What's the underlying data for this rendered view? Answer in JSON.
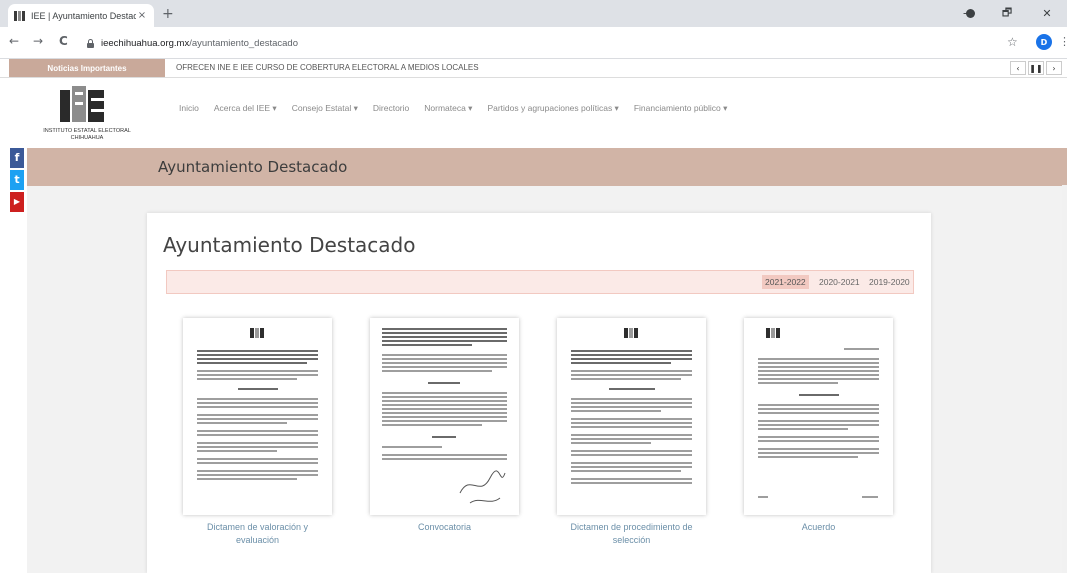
{
  "browser": {
    "tab_title": "IEE | Ayuntamiento Destacado",
    "tab_close": "×",
    "new_tab": "+",
    "url_domain": "ieechihuahua.org.mx",
    "url_path": "/ayuntamiento_destacado",
    "profile_initial": "D",
    "back": "←",
    "forward": "→",
    "reload": "C",
    "star": "☆",
    "menu": "⋮",
    "minimize": "−",
    "maximize": "🗗",
    "close": "✕"
  },
  "ticker": {
    "label": "Noticias Importantes",
    "text": "OFRECEN INE E IEE CURSO DE COBERTURA ELECTORAL A MEDIOS LOCALES",
    "prev": "‹",
    "pause": "❚❚",
    "next": "›"
  },
  "header": {
    "logo_text_1": "INSTITUTO ESTATAL ELECTORAL",
    "logo_text_2": "CHIHUAHUA",
    "nav": [
      "Inicio",
      "Acerca del IEE ▾",
      "Consejo Estatal ▾",
      "Directorio",
      "Normateca ▾",
      "Partidos y agrupaciones políticas ▾",
      "Financiamiento público ▾"
    ]
  },
  "social": {
    "facebook": "f",
    "twitter": "t",
    "youtube": "▶"
  },
  "band": {
    "title": "Ayuntamiento Destacado"
  },
  "card": {
    "title": "Ayuntamiento Destacado",
    "years": [
      "2021-2022",
      "2020-2021",
      "2019-2020"
    ],
    "active_year": "2021-2022",
    "documents": [
      {
        "caption_1": "Dictamen de valoración y",
        "caption_2": "evaluación"
      },
      {
        "caption_1": "Convocatoria",
        "caption_2": ""
      },
      {
        "caption_1": "Dictamen de procedimiento de",
        "caption_2": "selección"
      },
      {
        "caption_1": "Acuerdo",
        "caption_2": ""
      }
    ]
  },
  "colors": {
    "band": "#d1b4a6",
    "ticker_label": "#c9a99a",
    "year_tab_bg": "#fbeae7",
    "year_active": "#f2c9c1",
    "caption": "#6b8fa8",
    "facebook": "#3b5998",
    "twitter": "#1da1f2",
    "youtube": "#cd201f"
  }
}
